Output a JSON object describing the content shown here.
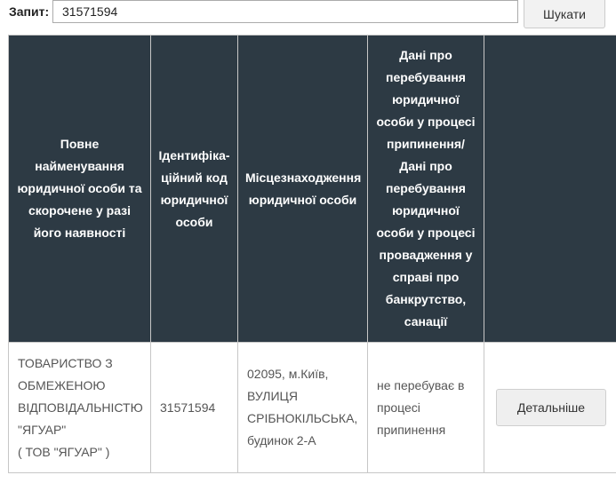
{
  "search": {
    "label": "Запит:",
    "value": "31571594",
    "button_label": "Шукати"
  },
  "table": {
    "headers": [
      "Повне найменування юридичної особи та скорочене у разі його наявності",
      "Ідентифіка-ційний код юридичної особи",
      "Місцезнаходження юридичної особи",
      "Дані про перебування юридичної особи у процесі припинення/ Дані про перебування юридичної особи у процесі провадження у справі про банкрутство, санації",
      ""
    ],
    "rows": [
      {
        "name_lines": [
          "ТОВАРИСТВО З",
          "ОБМЕЖЕНОЮ",
          "ВІДПОВІДАЛЬНІСТЮ",
          "\"ЯГУАР\"",
          "( ТОВ \"ЯГУАР\" )"
        ],
        "code": "31571594",
        "location_lines": [
          "02095, м.Київ,",
          "ВУЛИЦЯ",
          "СРІБНОКІЛЬСЬКА,",
          "будинок 2-А"
        ],
        "status": "не перебуває в процесі припинення",
        "action_label": "Детальніше"
      }
    ]
  }
}
